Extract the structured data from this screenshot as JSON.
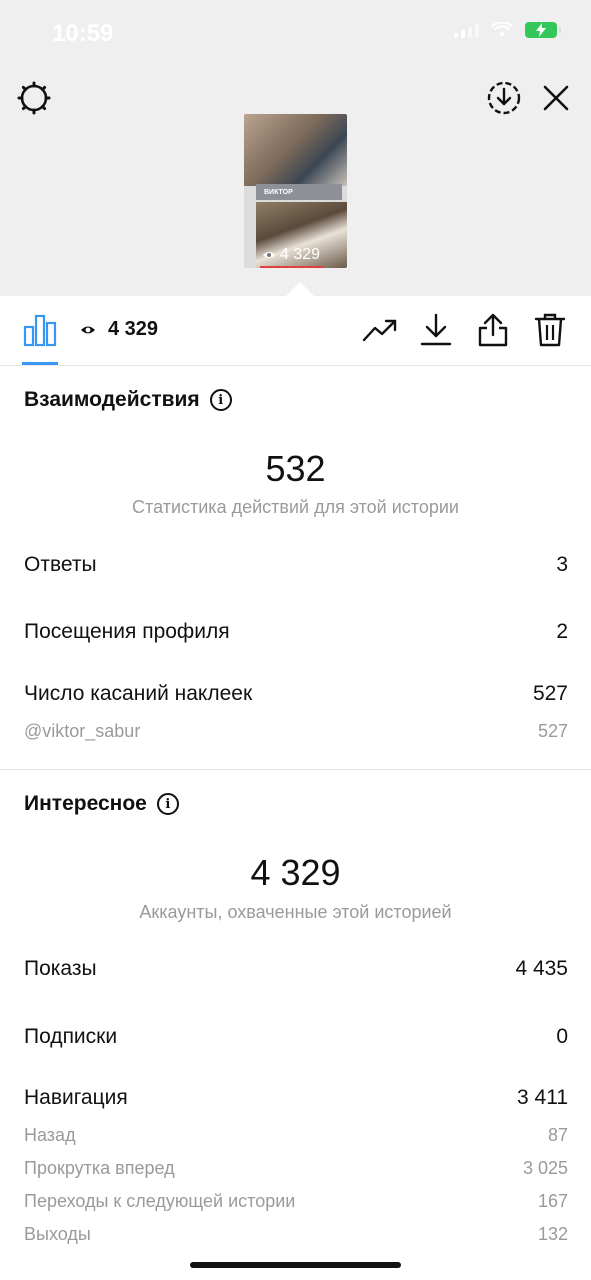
{
  "status_bar": {
    "time": "10:59"
  },
  "story_preview": {
    "name_tag": "ВИКТОР",
    "views": "4 329"
  },
  "toolbar": {
    "view_count": "4 329",
    "icons": [
      "bar-chart-icon",
      "eye-icon",
      "trending-up-icon",
      "download-icon",
      "share-icon",
      "trash-icon"
    ]
  },
  "interactions": {
    "title": "Взаимодействия",
    "total": "532",
    "caption": "Статистика действий для этой истории",
    "rows": [
      {
        "label": "Ответы",
        "value": "3"
      },
      {
        "label": "Посещения профиля",
        "value": "2"
      },
      {
        "label": "Число касаний наклеек",
        "value": "527"
      }
    ],
    "sub_rows": [
      {
        "label": "@viktor_sabur",
        "value": "527"
      }
    ]
  },
  "discovery": {
    "title": "Интересное",
    "total": "4 329",
    "caption": "Аккаунты, охваченные этой историей",
    "rows": [
      {
        "label": "Показы",
        "value": "4 435"
      },
      {
        "label": "Подписки",
        "value": "0"
      },
      {
        "label": "Навигация",
        "value": "3 411"
      }
    ],
    "sub_rows": [
      {
        "label": "Назад",
        "value": "87"
      },
      {
        "label": "Прокрутка вперед",
        "value": "3 025"
      },
      {
        "label": "Переходы к следующей истории",
        "value": "167"
      },
      {
        "label": "Выходы",
        "value": "132"
      }
    ]
  },
  "colors": {
    "accent": "#3897f0",
    "battery": "#33c759",
    "muted": "#9a9a9a"
  }
}
